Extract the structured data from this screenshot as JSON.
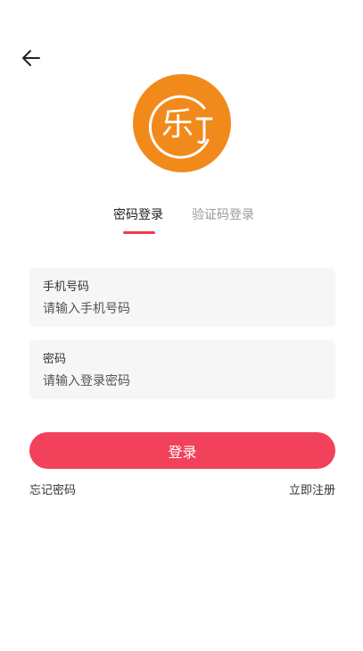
{
  "header": {
    "back_icon": "arrow-left-icon"
  },
  "logo": {
    "text": "乐",
    "bg_color": "#f28a1b",
    "icon": "le-brand-logo-icon"
  },
  "tabs": [
    {
      "label": "密码登录",
      "active": true
    },
    {
      "label": "验证码登录",
      "active": false
    }
  ],
  "form": {
    "phone": {
      "label": "手机号码",
      "placeholder": "请输入手机号码",
      "value": ""
    },
    "password": {
      "label": "密码",
      "placeholder": "请输入登录密码",
      "value": ""
    }
  },
  "actions": {
    "login_label": "登录",
    "forgot_label": "忘记密码",
    "register_label": "立即注册"
  },
  "colors": {
    "accent": "#f2415a",
    "tab_underline": "#f2384f",
    "logo": "#f28a1b"
  }
}
